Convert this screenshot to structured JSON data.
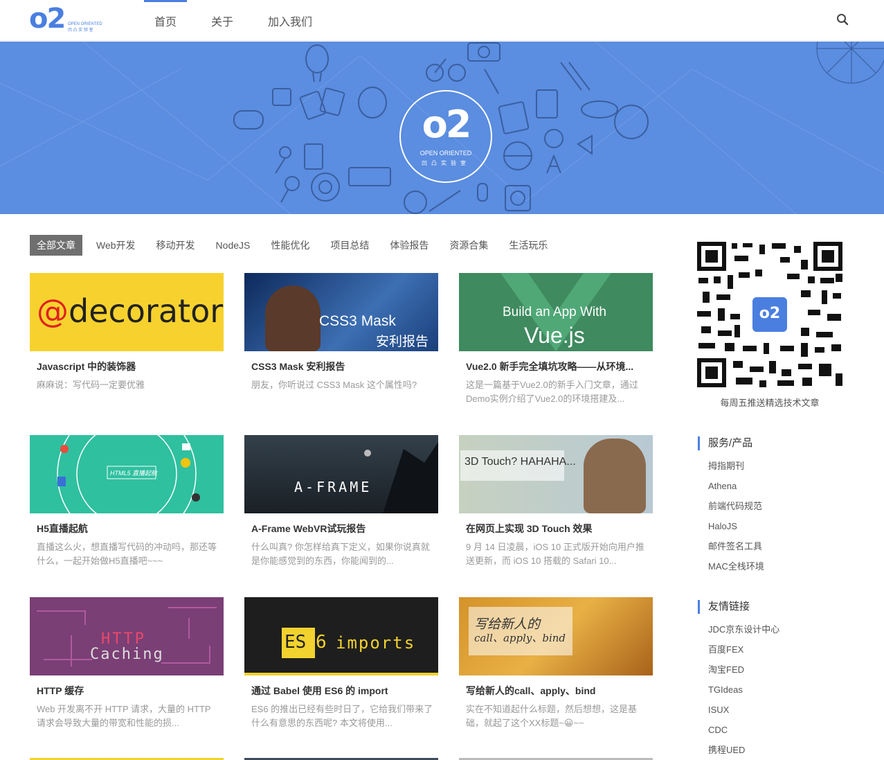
{
  "header": {
    "logo_mark": "o2",
    "logo_line1": "OPEN ORIENTED",
    "logo_line2": "凹 凸 实 验 室",
    "nav": [
      "首页",
      "关于",
      "加入我们"
    ]
  },
  "banner": {
    "logo_mark": "o2",
    "logo_line1": "OPEN ORIENTED",
    "logo_line2": "凹凸实验室"
  },
  "categories": [
    "全部文章",
    "Web开发",
    "移动开发",
    "NodeJS",
    "性能优化",
    "项目总结",
    "体验报告",
    "资源合集",
    "生活玩乐"
  ],
  "posts": [
    {
      "thumb_text": "@decorator",
      "title": "Javascript 中的装饰器",
      "desc": "麻麻说：写代码一定要优雅"
    },
    {
      "thumb_text": "CSS3 Mask",
      "thumb_text2": "安利报告",
      "title": "CSS3 Mask 安利报告",
      "desc": "朋友，你听说过 CSS3 Mask 这个属性吗?"
    },
    {
      "thumb_text": "Build an App With",
      "thumb_text2": "Vue.js",
      "title": "Vue2.0 新手完全填坑攻略——从环境...",
      "desc": "这是一篇基于Vue2.0的新手入门文章，通过Demo实例介绍了Vue2.0的环境搭建及..."
    },
    {
      "thumb_text": "HTML5 直播起航",
      "title": "H5直播起航",
      "desc": "直播这么火，想直播写代码的冲动吗，那还等什么，一起开始做H5直播吧~~~"
    },
    {
      "thumb_text": "A-FRAME",
      "title": "A-Frame WebVR试玩报告",
      "desc": "什么叫真? 你怎样给真下定义，如果你说真就是你能感觉到的东西，你能闻到的..."
    },
    {
      "thumb_text": "3D Touch? HAHAHA...",
      "title": "在网页上实现 3D Touch 效果",
      "desc": "9 月 14 日凌晨，iOS 10 正式版开始向用户推送更新，而 iOS 10 搭载的 Safari 10..."
    },
    {
      "thumb_text": "HTTP",
      "thumb_text2": "Caching",
      "title": "HTTP 缓存",
      "desc": "Web 开发离不开 HTTP 请求，大量的 HTTP 请求会导致大量的带宽和性能的损..."
    },
    {
      "thumb_text": "ES",
      "thumb_text2": "6",
      "thumb_text3": "imports",
      "title": "通过 Babel 使用 ES6 的 import",
      "desc": "ES6 的推出已经有些时日了，它给我们带来了什么有意思的东西呢? 本文将使用..."
    },
    {
      "thumb_text": "写给新人的",
      "thumb_text2": "call、apply、bind",
      "title": "写给新人的call、apply、bind",
      "desc": "实在不知道起什么标题，然后想想，这是基础，就起了这个XX标题~😀~~"
    }
  ],
  "sidebar": {
    "qr_caption": "每周五推送精选技术文章",
    "qr_badge": "o2",
    "sections": [
      {
        "title": "服务/产品",
        "items": [
          "拇指期刊",
          "Athena",
          "前端代码规范",
          "HaloJS",
          "邮件签名工具",
          "MAC全栈环境"
        ]
      },
      {
        "title": "友情链接",
        "items": [
          "JDC京东设计中心",
          "百度FEX",
          "淘宝FED",
          "TGIdeas",
          "ISUX",
          "CDC",
          "携程UED"
        ]
      }
    ]
  },
  "colors": {
    "brand": "#4a7fe0",
    "banner": "#5b8de0",
    "tab_active": "#6f6f6f"
  }
}
